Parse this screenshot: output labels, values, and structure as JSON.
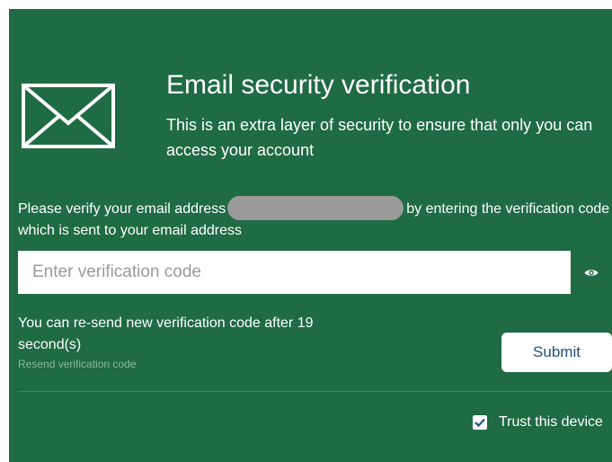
{
  "header": {
    "icon": "envelope-icon",
    "title": "Email security verification",
    "subtitle": "This is an extra layer of security to ensure that only you can access your account"
  },
  "verify": {
    "text_before": "Please verify your email address",
    "text_after": "by entering the verification code which is sent to your email address"
  },
  "code_input": {
    "placeholder": "Enter verification code",
    "value": "",
    "toggle_icon": "eye-icon"
  },
  "resend": {
    "countdown_text": "You can re-send new verification code after 19 second(s)",
    "link_label": "Resend verification code"
  },
  "submit": {
    "label": "Submit"
  },
  "trust": {
    "label": "Trust this device",
    "checked": true,
    "icon": "checkmark-icon"
  },
  "colors": {
    "panel_background": "#1f6b43",
    "button_text": "#1f4f7a",
    "redaction": "#9a9a9a",
    "checkmark": "#1f4f7a"
  }
}
